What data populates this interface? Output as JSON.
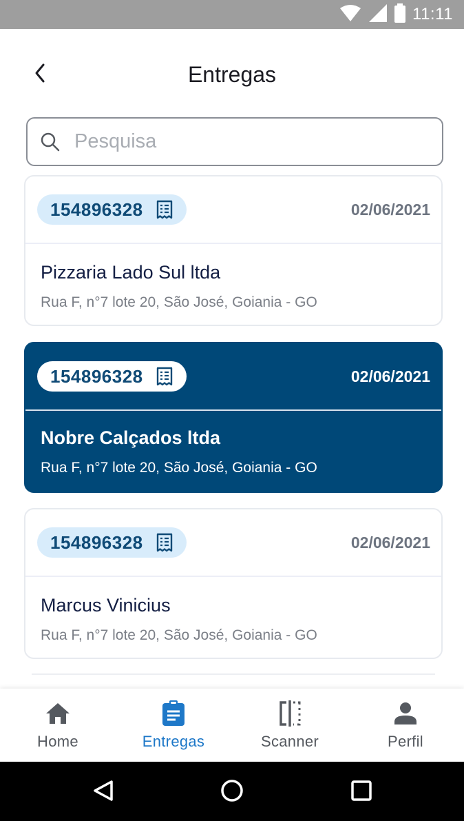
{
  "status_bar": {
    "time": "11:11",
    "icons": [
      "wifi-icon",
      "signal-icon",
      "battery-icon"
    ]
  },
  "header": {
    "title": "Entregas",
    "back_icon": "chevron-left-icon"
  },
  "search": {
    "placeholder": "Pesquisa",
    "value": "",
    "icon": "search-icon"
  },
  "deliveries": [
    {
      "code": "154896328",
      "date": "02/06/2021",
      "name": "Pizzaria Lado Sul ltda",
      "address": "Rua F, n°7 lote 20, São José, Goiania - GO",
      "selected": false
    },
    {
      "code": "154896328",
      "date": "02/06/2021",
      "name": "Nobre Calçados ltda",
      "address": "Rua F, n°7 lote 20, São José, Goiania - GO",
      "selected": true
    },
    {
      "code": "154896328",
      "date": "02/06/2021",
      "name": "Marcus Vinicius",
      "address": "Rua F, n°7 lote 20, São José, Goiania - GO",
      "selected": false
    }
  ],
  "bottom_nav": [
    {
      "label": "Home",
      "icon": "home-icon",
      "active": false
    },
    {
      "label": "Entregas",
      "icon": "clipboard-icon",
      "active": true
    },
    {
      "label": "Scanner",
      "icon": "scanner-icon",
      "active": false
    },
    {
      "label": "Perfil",
      "icon": "person-icon",
      "active": false
    }
  ],
  "colors": {
    "primary": "#004878",
    "badge_bg": "#d8ecfb",
    "active_nav": "#1e78c8",
    "status_bar": "#9e9e9e"
  }
}
